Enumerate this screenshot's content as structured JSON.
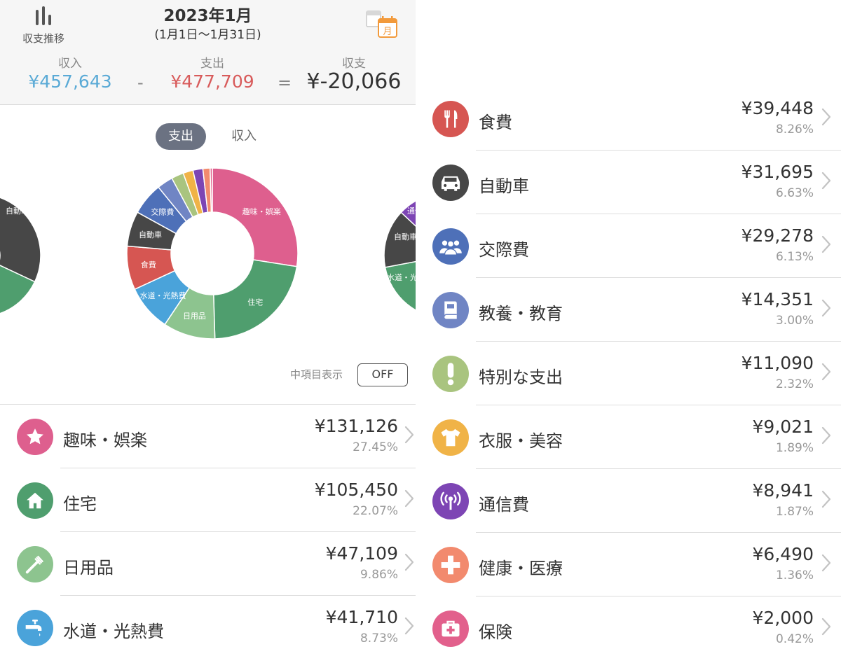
{
  "header": {
    "trend_label": "収支推移",
    "month": "2023年1月",
    "range": "(1月1日〜1月31日)",
    "calendar_icon_text": "月"
  },
  "summary": {
    "income_label": "収入",
    "income_value": "¥457,643",
    "minus": "-",
    "expense_label": "支出",
    "expense_value": "¥477,709",
    "equals": "=",
    "balance_label": "収支",
    "balance_value": "¥-20,066",
    "colors": {
      "income": "#5aaad6",
      "expense": "#d85b5b",
      "balance": "#333333"
    }
  },
  "tabs": {
    "expense": "支出",
    "income": "収入"
  },
  "subcategory_toggle": {
    "label": "中項目表示",
    "state": "OFF"
  },
  "chart_data": {
    "type": "pie",
    "title": "",
    "categories": [
      "趣味・娯楽",
      "住宅",
      "日用品",
      "水道・光熱費",
      "食費",
      "自動車",
      "交際費",
      "教養・教育",
      "特別な支出",
      "衣服・美容",
      "通信費",
      "健康・医療",
      "保険"
    ],
    "values": [
      131126,
      105450,
      47109,
      41710,
      39448,
      31695,
      29278,
      14351,
      11090,
      9021,
      8941,
      6490,
      2000
    ],
    "labeled_slices": [
      "趣味・娯楽",
      "住宅",
      "日用品",
      "水道・光熱費",
      "食費",
      "自動車",
      "交際費"
    ],
    "colors": [
      "#de5f8e",
      "#4f9e6e",
      "#8dc48f",
      "#4aa3da",
      "#d65652",
      "#474747",
      "#4e70b8",
      "#7085c4",
      "#a9c47f",
      "#f0b347",
      "#7d45b4",
      "#f28a6e",
      "#e2608c"
    ],
    "side_left_labels": [
      "自動車"
    ],
    "side_right_labels": [
      "通信",
      "自動車",
      "水道・光"
    ]
  },
  "categories": [
    {
      "name": "趣味・娯楽",
      "amount": "¥131,126",
      "pct": "27.45%",
      "color": "#de5f8e",
      "icon": "star-icon"
    },
    {
      "name": "住宅",
      "amount": "¥105,450",
      "pct": "22.07%",
      "color": "#4f9e6e",
      "icon": "house-icon"
    },
    {
      "name": "日用品",
      "amount": "¥47,109",
      "pct": "9.86%",
      "color": "#8dc48f",
      "icon": "toothbrush-icon"
    },
    {
      "name": "水道・光熱費",
      "amount": "¥41,710",
      "pct": "8.73%",
      "color": "#4aa3da",
      "icon": "faucet-icon"
    },
    {
      "name": "食費",
      "amount": "¥39,448",
      "pct": "8.26%",
      "color": "#d65652",
      "icon": "fork-knife-icon"
    },
    {
      "name": "自動車",
      "amount": "¥31,695",
      "pct": "6.63%",
      "color": "#474747",
      "icon": "car-icon"
    },
    {
      "name": "交際費",
      "amount": "¥29,278",
      "pct": "6.13%",
      "color": "#4e70b8",
      "icon": "people-icon"
    },
    {
      "name": "教養・教育",
      "amount": "¥14,351",
      "pct": "3.00%",
      "color": "#7085c4",
      "icon": "book-icon"
    },
    {
      "name": "特別な支出",
      "amount": "¥11,090",
      "pct": "2.32%",
      "color": "#a9c47f",
      "icon": "exclamation-icon"
    },
    {
      "name": "衣服・美容",
      "amount": "¥9,021",
      "pct": "1.89%",
      "color": "#f0b347",
      "icon": "tshirt-icon"
    },
    {
      "name": "通信費",
      "amount": "¥8,941",
      "pct": "1.87%",
      "color": "#7d45b4",
      "icon": "antenna-icon"
    },
    {
      "name": "健康・医療",
      "amount": "¥6,490",
      "pct": "1.36%",
      "color": "#f28a6e",
      "icon": "cross-icon"
    },
    {
      "name": "保険",
      "amount": "¥2,000",
      "pct": "0.42%",
      "color": "#e2608c",
      "icon": "first-aid-icon"
    }
  ]
}
